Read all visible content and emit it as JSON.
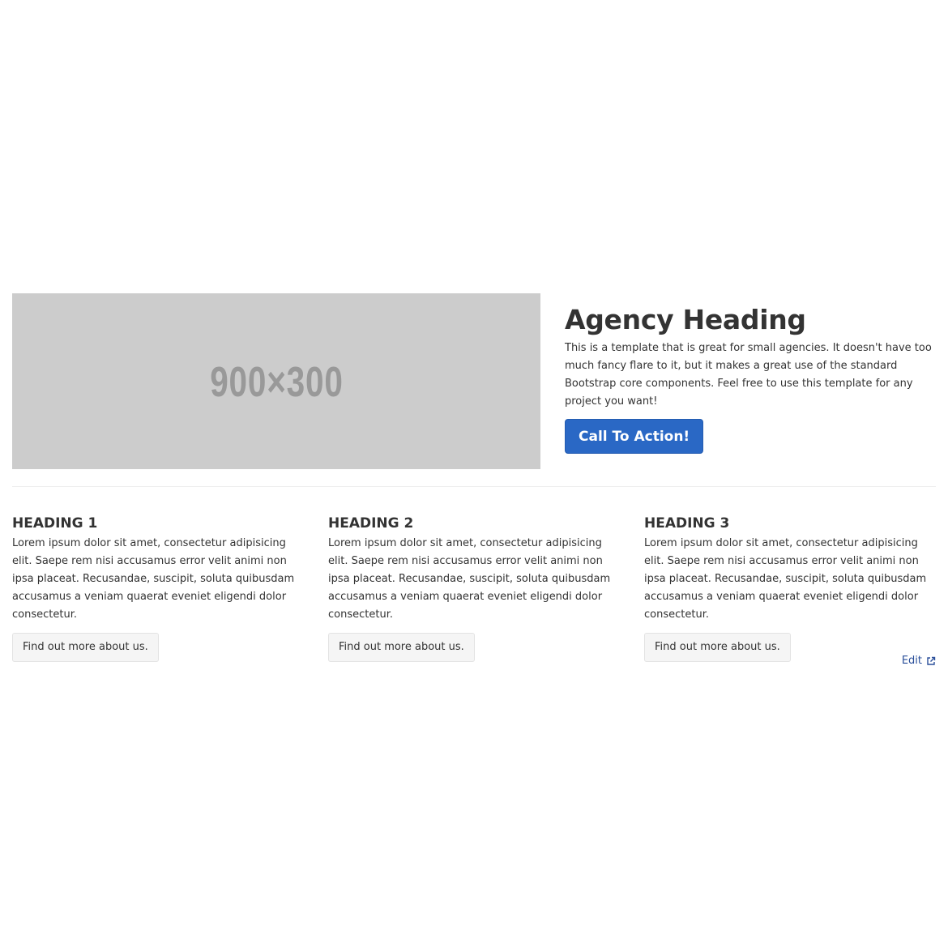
{
  "hero": {
    "image_placeholder": "900×300",
    "heading": "Agency Heading",
    "text": "This is a template that is great for small agencies. It doesn't have too much fancy flare to it, but it makes a great use of the standard Bootstrap core components. Feel free to use this template for any project you want!",
    "cta_label": "Call To Action!"
  },
  "features": [
    {
      "heading": "HEADING 1",
      "text": "Lorem ipsum dolor sit amet, consectetur adipisicing elit. Saepe rem nisi accusamus error velit animi non ipsa placeat. Recusandae, suscipit, soluta quibusdam accusamus a veniam quaerat eveniet eligendi dolor consectetur.",
      "button_label": "Find out more about us."
    },
    {
      "heading": "HEADING 2",
      "text": "Lorem ipsum dolor sit amet, consectetur adipisicing elit. Saepe rem nisi accusamus error velit animi non ipsa placeat. Recusandae, suscipit, soluta quibusdam accusamus a veniam quaerat eveniet eligendi dolor consectetur.",
      "button_label": "Find out more about us."
    },
    {
      "heading": "HEADING 3",
      "text": "Lorem ipsum dolor sit amet, consectetur adipisicing elit. Saepe rem nisi accusamus error velit animi non ipsa placeat. Recusandae, suscipit, soluta quibusdam accusamus a veniam quaerat eveniet eligendi dolor consectetur.",
      "button_label": "Find out more about us."
    }
  ],
  "footer": {
    "edit_label": "Edit",
    "edit_icon": "external-link-icon"
  },
  "colors": {
    "primary_button": "#2a68c5",
    "placeholder_bg": "#cccccc",
    "placeholder_text": "#999999",
    "link": "#2a4f9a",
    "text": "#333333"
  }
}
